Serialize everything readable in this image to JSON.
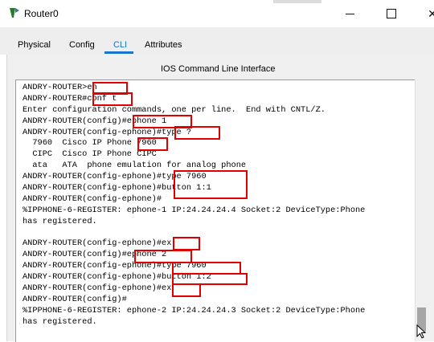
{
  "window": {
    "title": "Router0",
    "minimize_icon": "minimize-icon",
    "maximize_icon": "maximize-icon",
    "close_icon": "close-icon",
    "close_glyph": "✕"
  },
  "tabs": [
    {
      "label": "Physical",
      "active": false
    },
    {
      "label": "Config",
      "active": false
    },
    {
      "label": "CLI",
      "active": true
    },
    {
      "label": "Attributes",
      "active": false
    }
  ],
  "panel": {
    "title": "IOS Command Line Interface"
  },
  "terminal": {
    "lines": [
      "ANDRY-ROUTER>en",
      "ANDRY-ROUTER#conf t",
      "Enter configuration commands, one per line.  End with CNTL/Z.",
      "ANDRY-ROUTER(config)#ephone 1",
      "ANDRY-ROUTER(config-ephone)#type ?",
      "  7960  Cisco IP Phone 7960",
      "  CIPC  Cisco IP Phone CIPC",
      "  ata   ATA  phone emulation for analog phone",
      "ANDRY-ROUTER(config-ephone)#type 7960",
      "ANDRY-ROUTER(config-ephone)#button 1:1",
      "ANDRY-ROUTER(config-ephone)#",
      "%IPPHONE-6-REGISTER: ephone-1 IP:24.24.24.4 Socket:2 DeviceType:Phone",
      "has registered.",
      "",
      "ANDRY-ROUTER(config-ephone)#ex",
      "ANDRY-ROUTER(config)#ephone 2",
      "ANDRY-ROUTER(config-ephone)#type 7960",
      "ANDRY-ROUTER(config-ephone)#button 1:2",
      "ANDRY-ROUTER(config-ephone)#ex",
      "ANDRY-ROUTER(config)#",
      "%IPPHONE-6-REGISTER: ephone-2 IP:24.24.24.3 Socket:2 DeviceType:Phone",
      "has registered."
    ]
  },
  "colors": {
    "accent": "#1a74c9",
    "highlight": "#e00000"
  }
}
